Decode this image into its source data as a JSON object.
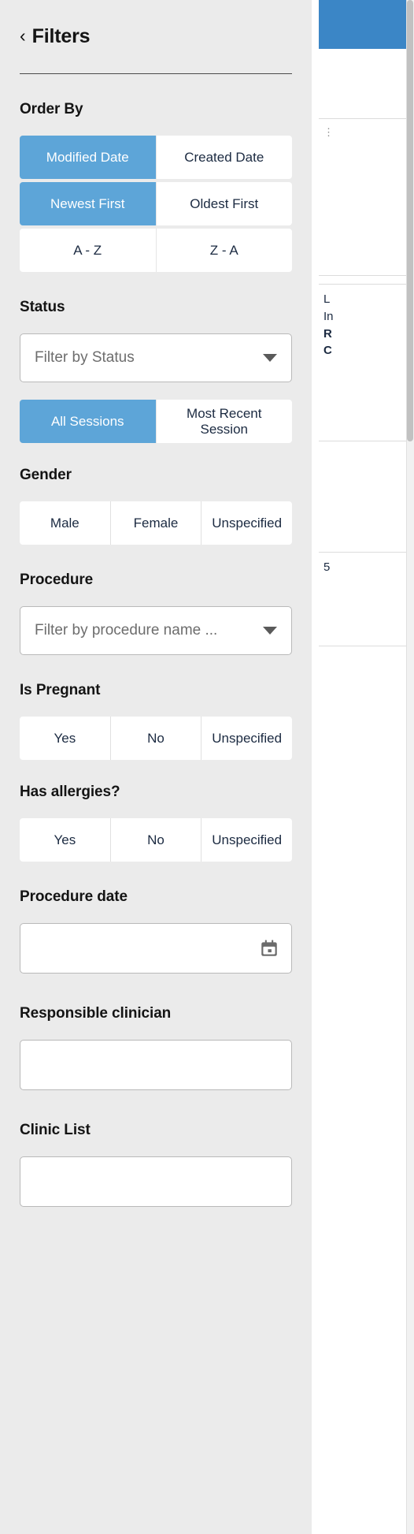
{
  "panel": {
    "back_chevron": "‹",
    "title": "Filters"
  },
  "colors": {
    "active_blue": "#5da5d8",
    "panel_background": "#ebebeb",
    "text_navy": "#1b2a41",
    "border_gray": "#b9b9b9",
    "placeholder_gray": "#6d6d6d"
  },
  "sections": {
    "order_by": {
      "label": "Order By",
      "rows": [
        {
          "options": [
            {
              "label": "Modified Date",
              "active": true
            },
            {
              "label": "Created Date",
              "active": false
            }
          ]
        },
        {
          "options": [
            {
              "label": "Newest First",
              "active": true
            },
            {
              "label": "Oldest First",
              "active": false
            }
          ]
        },
        {
          "options": [
            {
              "label": "A - Z",
              "active": false
            },
            {
              "label": "Z - A",
              "active": false
            }
          ]
        }
      ]
    },
    "status": {
      "label": "Status",
      "select_placeholder": "Filter by Status",
      "select_value": "",
      "caret_icon": "chevron-down-icon",
      "sessions": [
        {
          "label": "All Sessions",
          "active": true
        },
        {
          "label": "Most Recent Session",
          "active": false
        }
      ]
    },
    "gender": {
      "label": "Gender",
      "options": [
        {
          "label": "Male",
          "active": false
        },
        {
          "label": "Female",
          "active": false
        },
        {
          "label": "Unspecified",
          "active": false
        }
      ]
    },
    "procedure": {
      "label": "Procedure",
      "select_placeholder": "Filter by procedure name ...",
      "select_value": "",
      "caret_icon": "chevron-down-icon"
    },
    "is_pregnant": {
      "label": "Is Pregnant",
      "options": [
        {
          "label": "Yes",
          "active": false
        },
        {
          "label": "No",
          "active": false
        },
        {
          "label": "Unspecified",
          "active": false
        }
      ]
    },
    "has_allergies": {
      "label": "Has allergies?",
      "options": [
        {
          "label": "Yes",
          "active": false
        },
        {
          "label": "No",
          "active": false
        },
        {
          "label": "Unspecified",
          "active": false
        }
      ]
    },
    "procedure_date": {
      "label": "Procedure date",
      "value": "",
      "placeholder": "",
      "icon": "calendar-icon"
    },
    "responsible_clinician": {
      "label": "Responsible clinician",
      "value": "",
      "placeholder": ""
    },
    "clinic_list": {
      "label": "Clinic List",
      "value": "",
      "placeholder": ""
    }
  },
  "background": {
    "card1_line1": "⋮",
    "card2_line1": "L",
    "card2_line2": "In",
    "card2_line3": "R",
    "card2_line4": "C",
    "card3_line1": "5"
  }
}
